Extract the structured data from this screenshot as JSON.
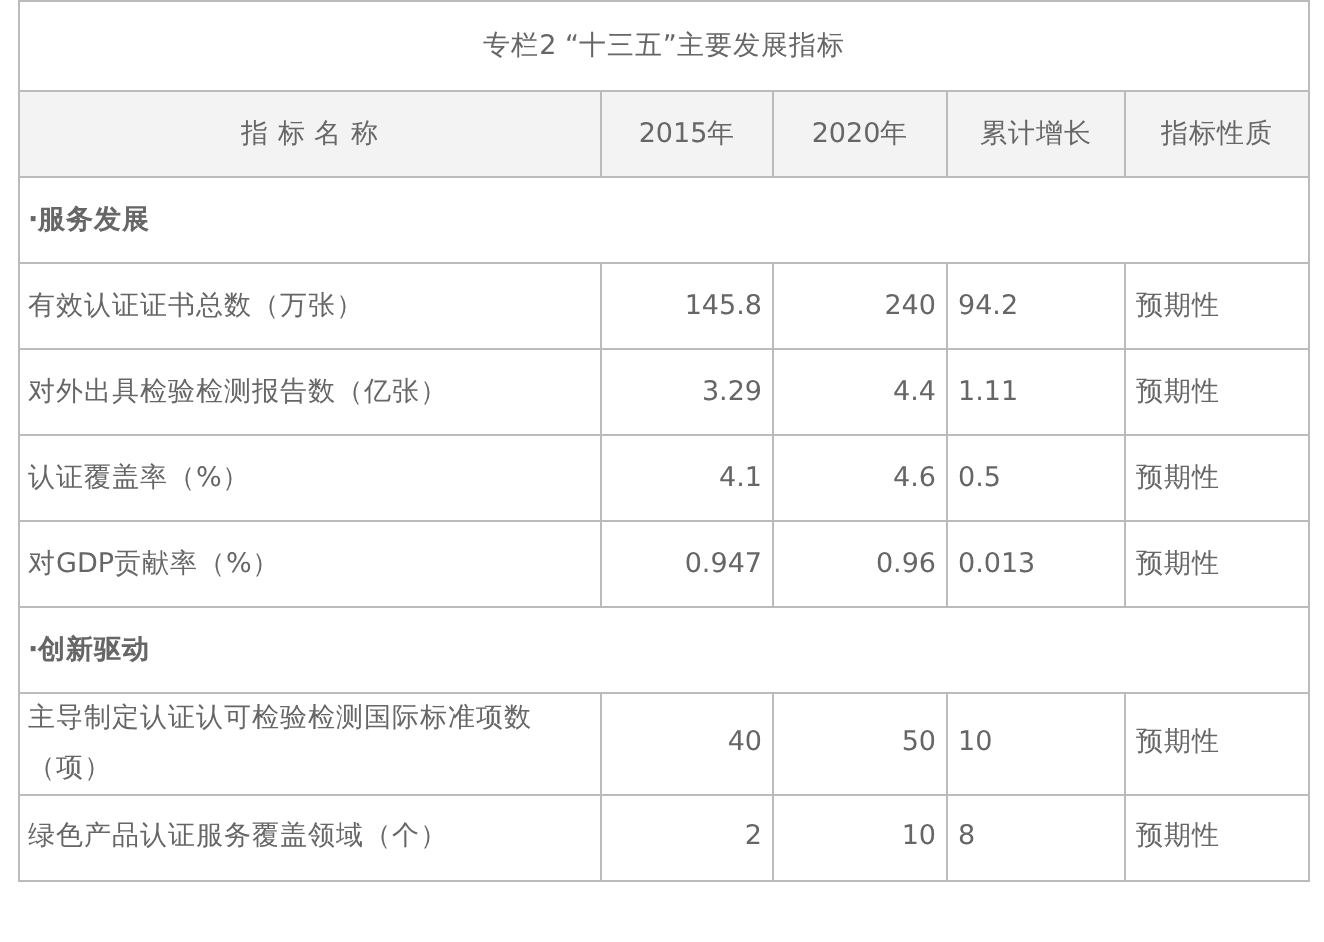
{
  "table": {
    "caption": "专栏2 “十三五”主要发展指标",
    "columns": [
      "指 标 名 称",
      "2015年",
      "2020年",
      "累计增长",
      "指标性质"
    ],
    "rows": [
      {
        "kind": "section",
        "label": "·服务发展"
      },
      {
        "kind": "data",
        "cells": [
          "有效认证证书总数（万张）",
          "145.8",
          "240",
          "94.2",
          "预期性"
        ]
      },
      {
        "kind": "data",
        "cells": [
          "对外出具检验检测报告数（亿张）",
          "3.29",
          "4.4",
          "1.11",
          "预期性"
        ]
      },
      {
        "kind": "data",
        "cells": [
          "认证覆盖率（%）",
          "4.1",
          "4.6",
          "0.5",
          "预期性"
        ]
      },
      {
        "kind": "data",
        "cells": [
          "对GDP贡献率（%）",
          "0.947",
          "0.96",
          "0.013",
          "预期性"
        ]
      },
      {
        "kind": "section",
        "label": "·创新驱动"
      },
      {
        "kind": "data",
        "cells": [
          "主导制定认证认可检验检测国际标准项数（项）",
          "40",
          "50",
          "10",
          "预期性"
        ]
      },
      {
        "kind": "data",
        "cells": [
          "绿色产品认证服务覆盖领域（个）",
          "2",
          "10",
          "8",
          "预期性"
        ]
      }
    ]
  }
}
